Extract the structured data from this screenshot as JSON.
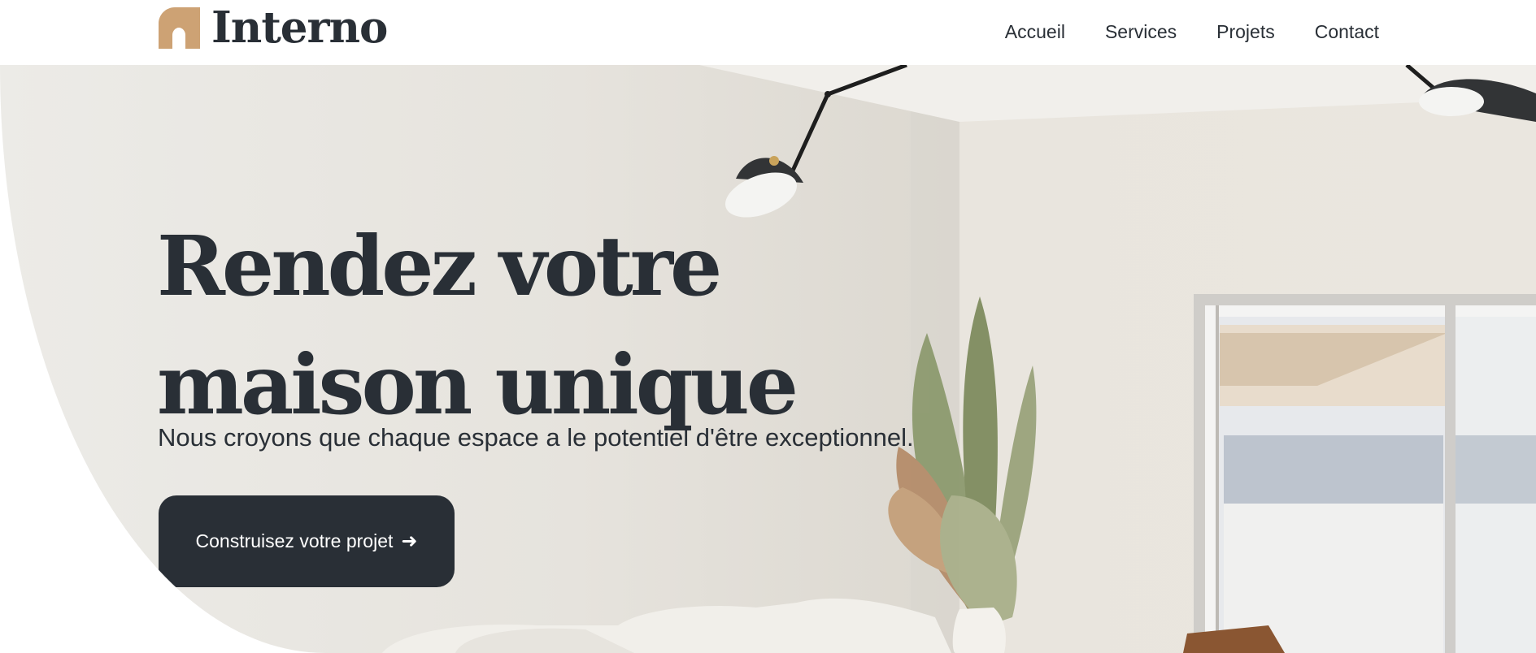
{
  "header": {
    "logo_text": "Interno",
    "nav": [
      "Accueil",
      "Services",
      "Projets",
      "Contact"
    ]
  },
  "hero": {
    "title_line1": "Rendez votre",
    "title_line2": "maison unique",
    "subtitle": "Nous croyons que chaque espace a le potentiel d'être exceptionnel.",
    "cta_label": "Construisez votre projet",
    "cta_icon": "arrow-right-icon"
  },
  "colors": {
    "text": "#292f36",
    "accent": "#cda274",
    "background": "#ffffff"
  }
}
